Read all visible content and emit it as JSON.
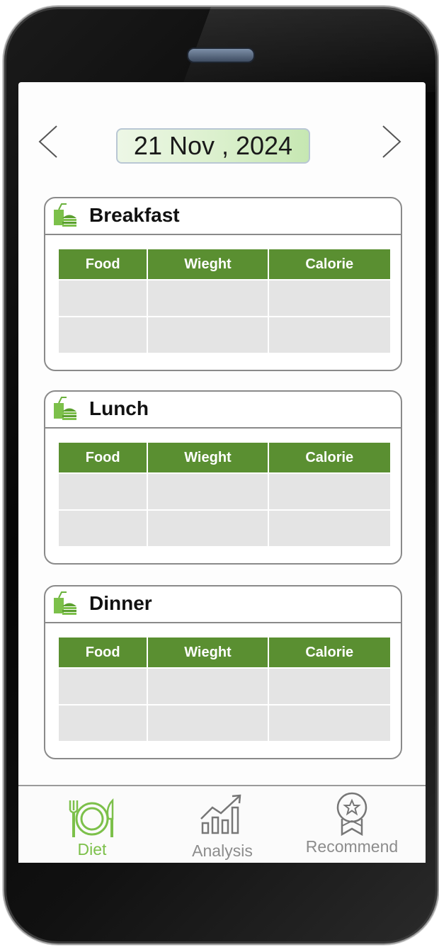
{
  "header": {
    "date": "21 Nov , 2024"
  },
  "meals": [
    {
      "title": "Breakfast",
      "columns": [
        "Food",
        "Wieght",
        "Calorie"
      ]
    },
    {
      "title": "Lunch",
      "columns": [
        "Food",
        "Wieght",
        "Calorie"
      ]
    },
    {
      "title": "Dinner",
      "columns": [
        "Food",
        "Wieght",
        "Calorie"
      ]
    }
  ],
  "bottom_nav": {
    "items": [
      {
        "label": "Diet",
        "icon": "plate-cutlery-icon",
        "active": true
      },
      {
        "label": "Analysis",
        "icon": "bar-chart-trend-icon",
        "active": false
      },
      {
        "label": "Recommend",
        "icon": "award-ribbon-icon",
        "active": false
      }
    ]
  },
  "colors": {
    "accent_green": "#5a8f31",
    "active_nav": "#7cc04a",
    "cell_gray": "#e4e4e4",
    "date_highlight": "#d8efc9"
  }
}
